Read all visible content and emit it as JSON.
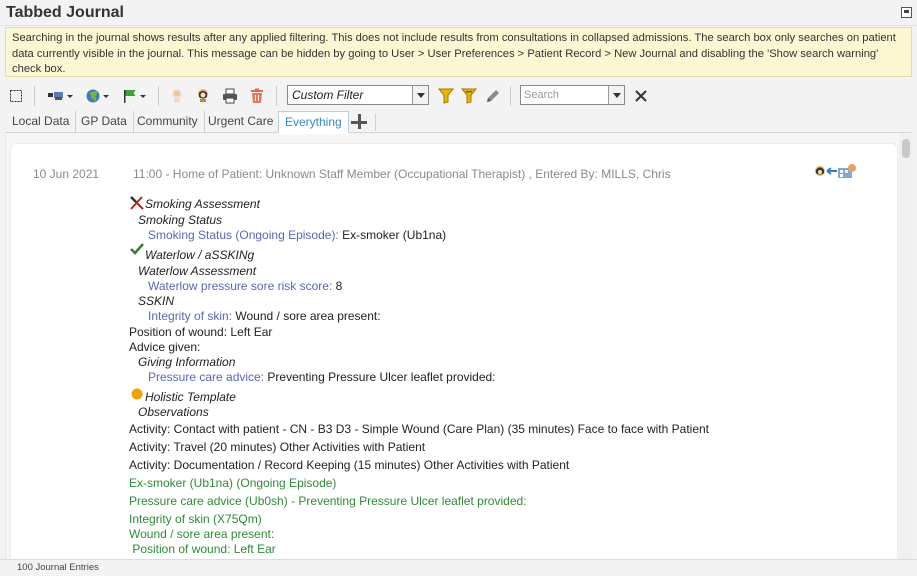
{
  "window": {
    "title": "Tabbed Journal"
  },
  "warning": {
    "text": "Searching in the journal shows results after any applied filtering. This does not include results from consultations in collapsed admissions. The search box only searches on patient data currently visible in the journal. This message can be hidden by going to User > User Preferences > Patient Record > New Journal and disabling the 'Show search warning' check box."
  },
  "toolbar": {
    "filter": {
      "value": "Custom Filter"
    },
    "search": {
      "placeholder": "Search",
      "value": ""
    }
  },
  "tabs": [
    {
      "label": "Local Data"
    },
    {
      "label": "GP Data"
    },
    {
      "label": "Community"
    },
    {
      "label": "Urgent Care"
    },
    {
      "label": "Everything",
      "active": true
    }
  ],
  "entry": {
    "date": "10 Jun 2021",
    "header": "11:00 - Home of Patient: Unknown Staff Member (Occupational Therapist) , Entered By: MILLS, Chris",
    "smoking": {
      "title": "Smoking Assessment",
      "section": "Smoking Status",
      "label": "Smoking Status (Ongoing Episode):",
      "value": " Ex-smoker (Ub1na)"
    },
    "waterlow": {
      "title": "Waterlow / aSSKINg",
      "section": "Waterlow Assessment",
      "label": "Waterlow pressure sore risk score:",
      "value": " 8",
      "sskin": "SSKIN",
      "skin_label": "Integrity of skin:",
      "skin_value": "  Wound / sore area present:",
      "position": "Position of wound: Left Ear",
      "advice": "Advice given:",
      "giving": "Giving Information",
      "pressure_label": "Pressure care advice:",
      "pressure_value": "  Preventing Pressure Ulcer leaflet provided:"
    },
    "holistic": {
      "title": "Holistic Template",
      "section": "Observations",
      "activities": [
        "Activity: Contact with patient - CN - B3 D3 - Simple Wound (Care Plan) (35 minutes) Face to face with Patient",
        "Activity: Travel (20 minutes) Other Activities with Patient",
        "Activity: Documentation / Record Keeping (15 minutes) Other Activities with Patient"
      ]
    },
    "coded": [
      "Ex-smoker (Ub1na) (Ongoing Episode)",
      "Pressure care advice (Ub0sh) - Preventing Pressure Ulcer leaflet provided:",
      "Integrity of skin (X75Qm)",
      "Wound / sore area present:",
      " Position of wound: Left Ear"
    ]
  },
  "status": {
    "text": "100 Journal Entries"
  },
  "colors": {
    "accent": "#3a86c8",
    "link": "#5a66b8",
    "coded": "#2e8b36",
    "warning_bg": "#fbf7d2"
  }
}
